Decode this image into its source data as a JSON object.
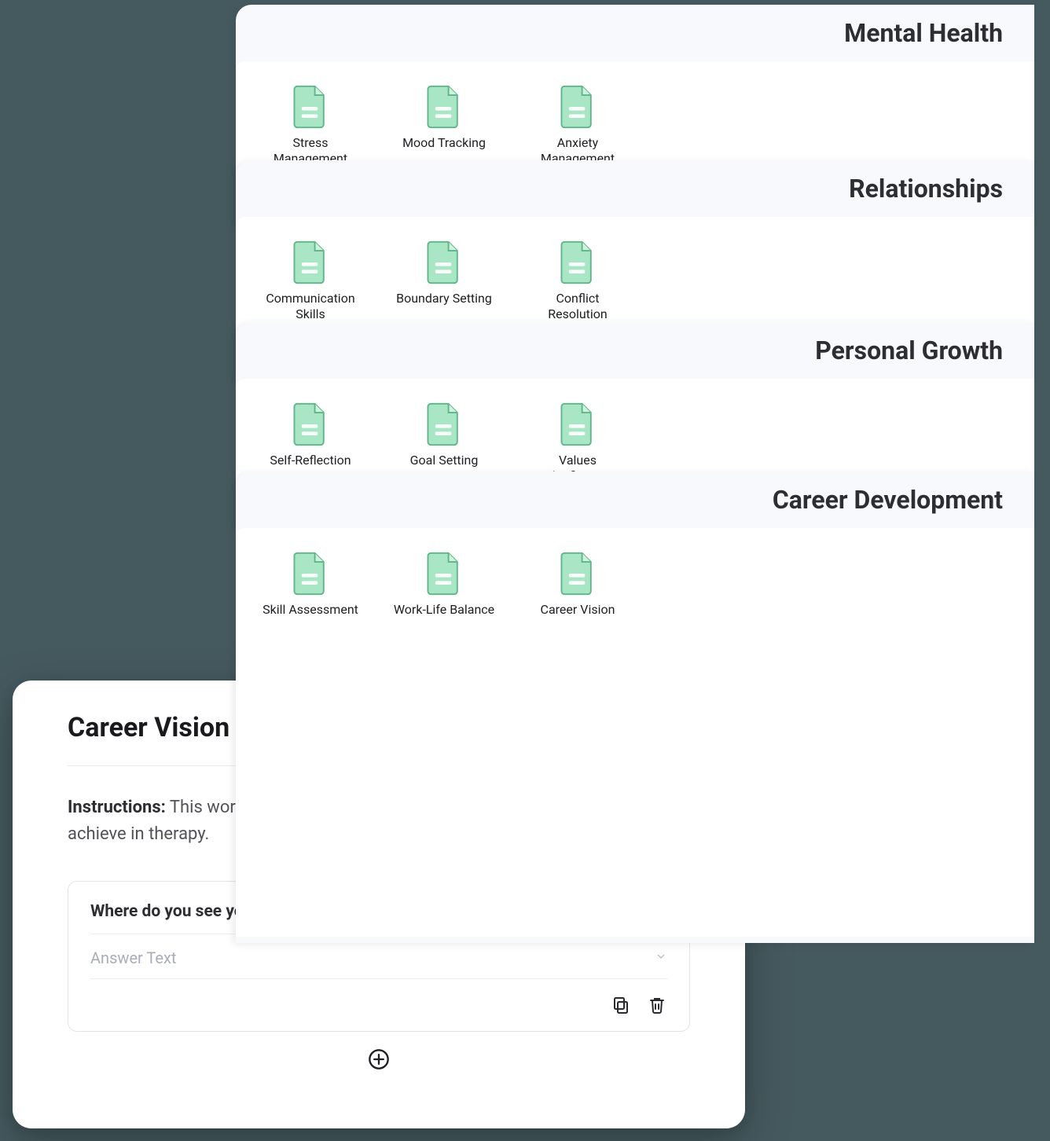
{
  "categories": [
    {
      "title": "Mental Health",
      "items": [
        "Stress Management",
        "Mood Tracking",
        "Anxiety Management"
      ]
    },
    {
      "title": "Relationships",
      "items": [
        "Communication Skills",
        "Boundary Setting",
        "Conflict Resolution"
      ]
    },
    {
      "title": "Personal Growth",
      "items": [
        "Self-Reflection",
        "Goal Setting",
        "Values Clarification"
      ]
    },
    {
      "title": "Career Development",
      "items": [
        "Skill Assessment",
        "Work-Life Balance",
        "Career Vision"
      ]
    }
  ],
  "card": {
    "title": "Career Vision",
    "instructions_label": "Instructions:",
    "instructions_text": "This worksheet will help you identify and define goals you'd like to achieve in therapy.",
    "question": "Where do you see yourself professionally in five years?",
    "answer_placeholder": "Answer Text"
  }
}
